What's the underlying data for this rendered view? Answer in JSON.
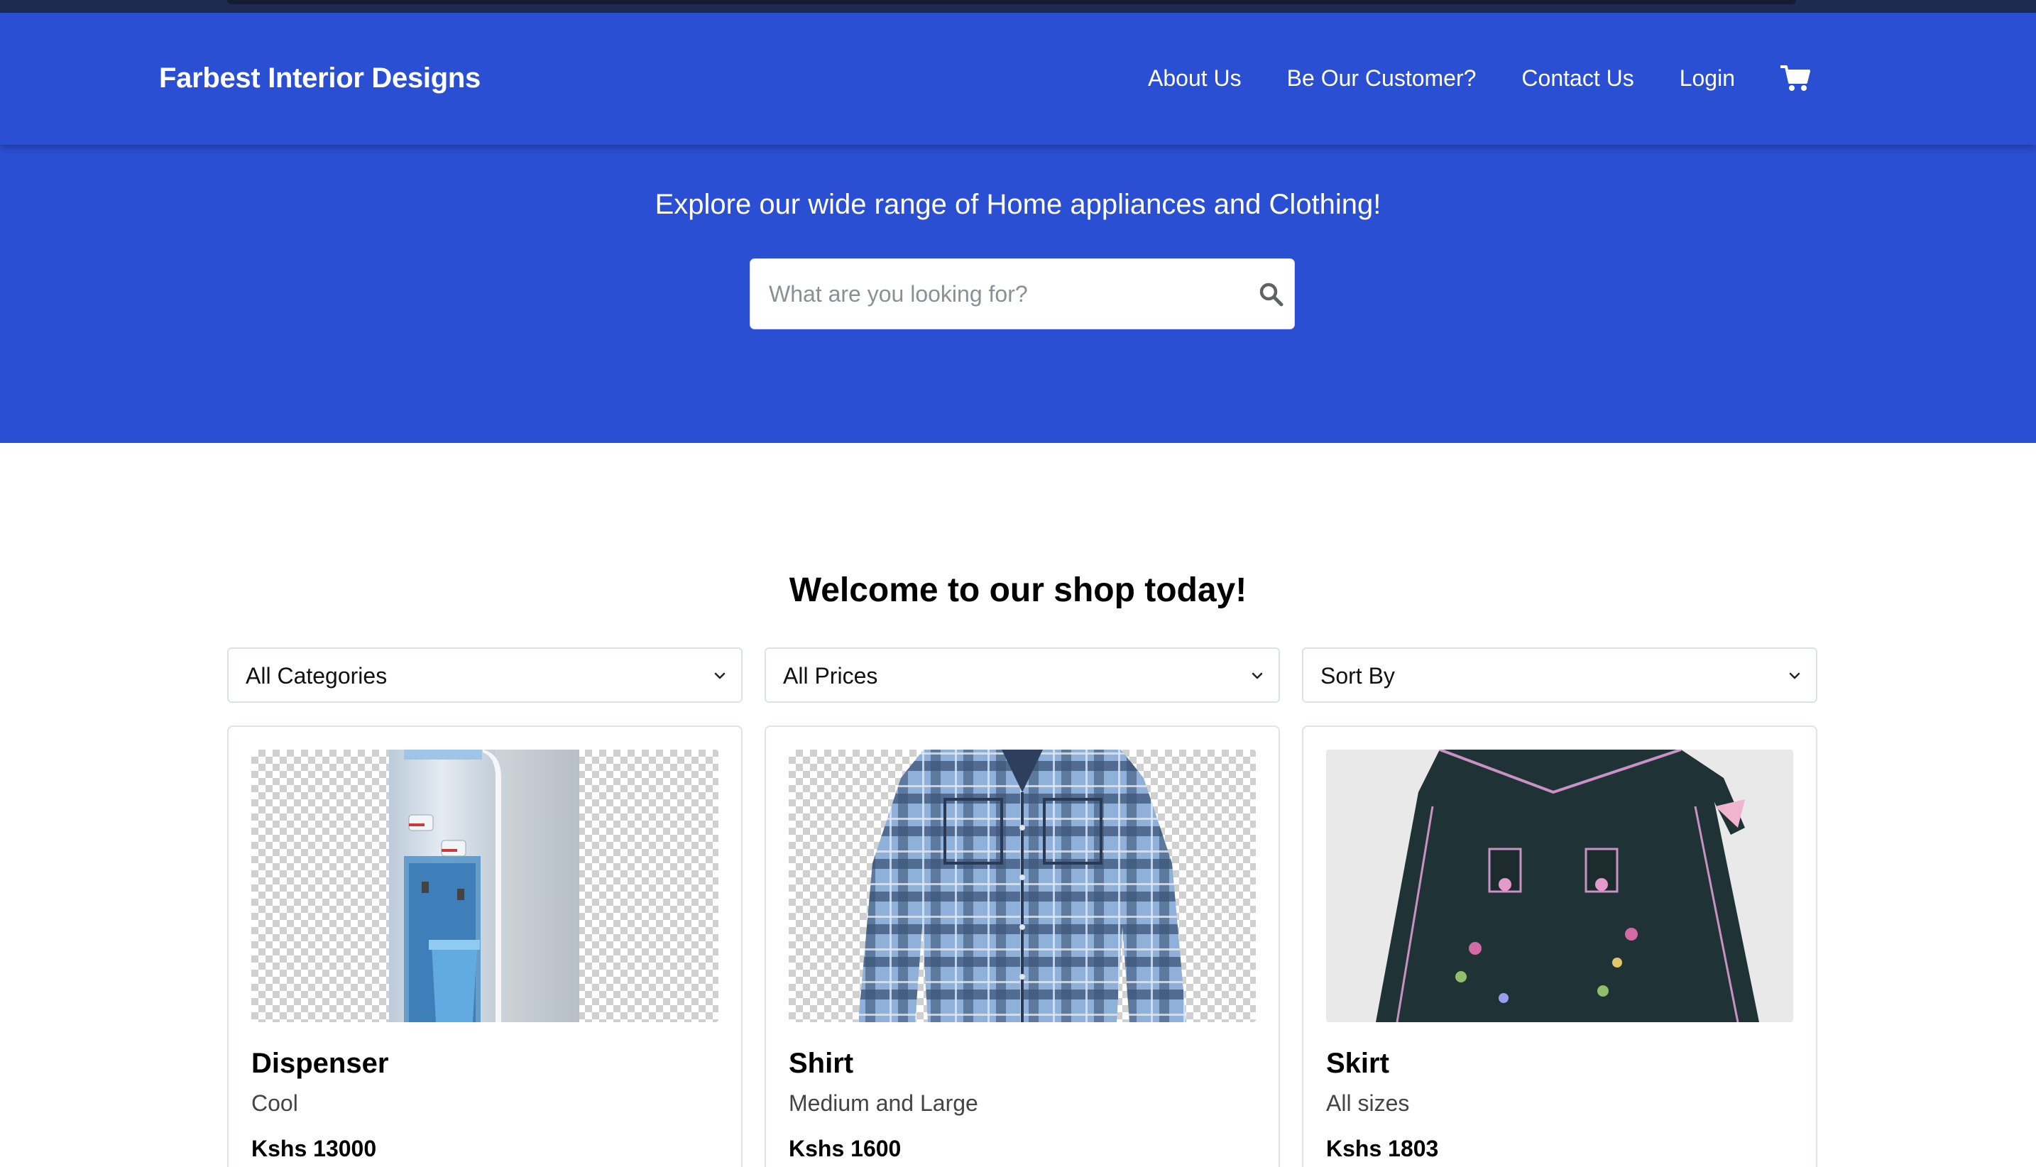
{
  "navbar": {
    "brand": "Farbest Interior Designs",
    "links": [
      "About Us",
      "Be Our Customer?",
      "Contact Us",
      "Login"
    ],
    "cart_icon": "shopping-cart-icon"
  },
  "hero": {
    "tagline": "Explore our wide range of Home appliances and Clothing!",
    "search_placeholder": "What are you looking for?",
    "search_value": "",
    "search_icon": "magnifier-icon"
  },
  "main": {
    "welcome": "Welcome to our shop today!",
    "filters": [
      {
        "selected": "All Categories"
      },
      {
        "selected": "All Prices"
      },
      {
        "selected": "Sort By"
      }
    ],
    "products": [
      {
        "name": "Dispenser",
        "description": "Cool",
        "price": "Kshs 13000"
      },
      {
        "name": "Shirt",
        "description": "Medium and Large",
        "price": "Kshs 1600"
      },
      {
        "name": "Skirt",
        "description": "All sizes",
        "price": "Kshs 1803"
      }
    ]
  },
  "colors": {
    "brand_blue": "#2b4fd3",
    "top_strip": "#1e2a4f",
    "white": "#ffffff"
  }
}
